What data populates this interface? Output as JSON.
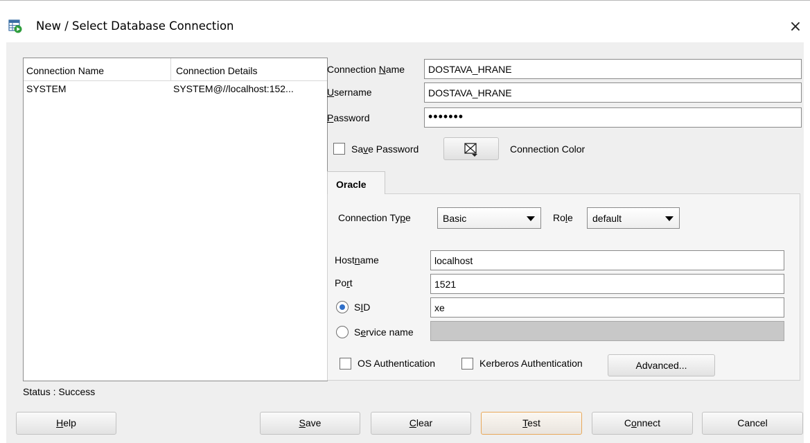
{
  "window": {
    "title": "New / Select Database Connection",
    "icon": "database-connection-icon",
    "close_glyph": "×"
  },
  "connection_list": {
    "columns": [
      "Connection Name",
      "Connection Details"
    ],
    "rows": [
      {
        "name": "SYSTEM",
        "details": "SYSTEM@//localhost:152..."
      }
    ]
  },
  "status": "Status : Success",
  "form": {
    "connection_name": {
      "label_pre": "Connection ",
      "label_key": "N",
      "label_post": "ame",
      "value": "DOSTAVA_HRANE"
    },
    "username": {
      "label_key": "U",
      "label_post": "sername",
      "value": "DOSTAVA_HRANE"
    },
    "password": {
      "label_key": "P",
      "label_post": "assword",
      "value": "•••••••"
    },
    "save_password": {
      "label_pre": "Sa",
      "label_key": "v",
      "label_post": "e Password",
      "checked": false
    },
    "connection_color": {
      "label": "Connection Color",
      "icon": "no-color-icon"
    }
  },
  "oracle_tab": {
    "tab_label": "Oracle",
    "connection_type": {
      "label_pre": "Connection Ty",
      "label_key": "p",
      "label_post": "e",
      "value": "Basic"
    },
    "role": {
      "label_pre": "Ro",
      "label_key": "l",
      "label_post": "e",
      "value": "default"
    },
    "hostname": {
      "label_pre": "Host",
      "label_key": "n",
      "label_post": "ame",
      "value": "localhost"
    },
    "port": {
      "label_pre": "Po",
      "label_key": "r",
      "label_post": "t",
      "value": "1521"
    },
    "sid": {
      "label_pre": "S",
      "label_key": "I",
      "label_post": "D",
      "value": "xe",
      "selected": true
    },
    "service_name": {
      "label_pre": "S",
      "label_key": "e",
      "label_post": "rvice name",
      "value": "",
      "selected": false
    },
    "os_auth": {
      "label": "OS Authentication",
      "checked": false
    },
    "kerberos_auth": {
      "label": "Kerberos Authentication",
      "checked": false
    },
    "advanced_label": "Advanced..."
  },
  "buttons": {
    "help": {
      "key": "H",
      "rest": "elp"
    },
    "save": {
      "key": "S",
      "rest": "ave"
    },
    "clear": {
      "key": "C",
      "rest": "lear"
    },
    "test": {
      "key": "T",
      "rest": "est"
    },
    "connect": {
      "pre": "C",
      "key": "o",
      "rest": "nnect"
    },
    "cancel": "Cancel"
  },
  "colors": {
    "dialog_background": "#efefef",
    "focus_border": "#e8a85a",
    "radio_dot": "#2f6fc9"
  }
}
